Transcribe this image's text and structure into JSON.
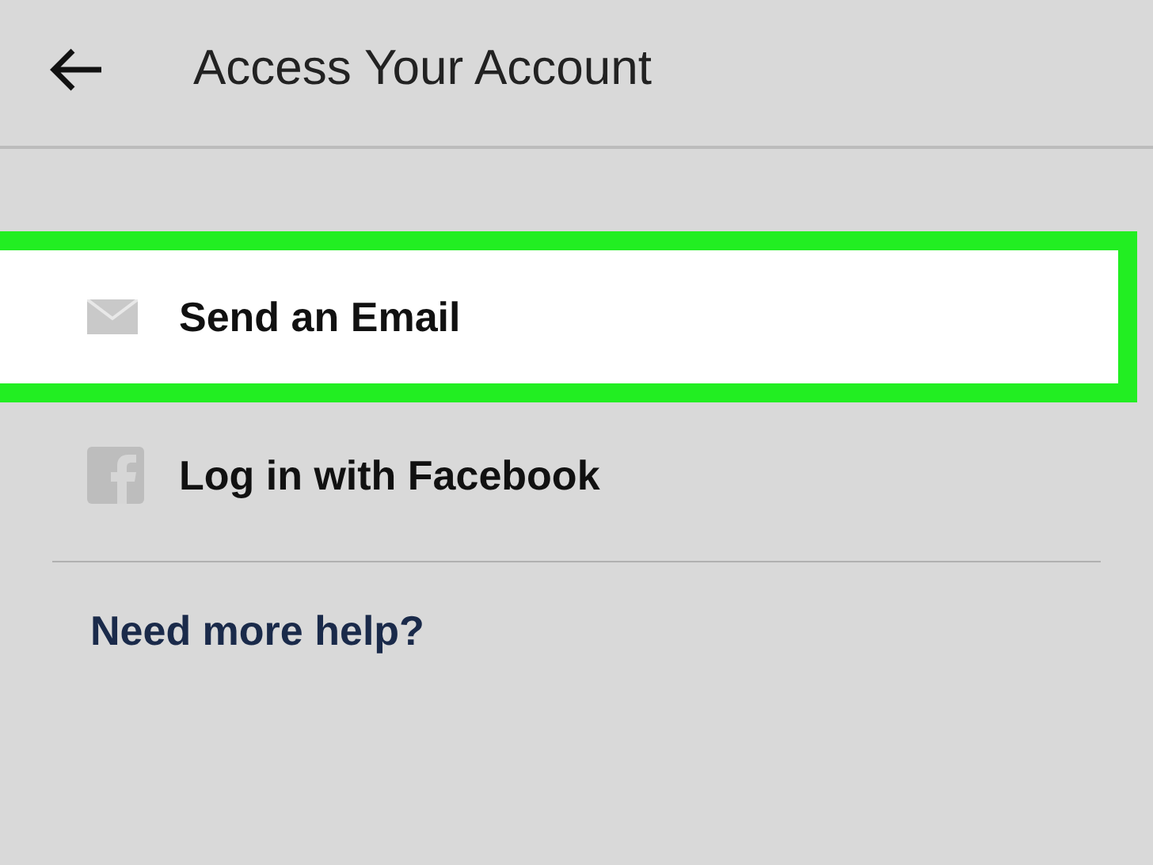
{
  "header": {
    "title": "Access Your Account"
  },
  "options": [
    {
      "kind": "email",
      "label": "Send an Email",
      "selected": true
    },
    {
      "kind": "facebook",
      "label": "Log in with Facebook",
      "selected": false
    }
  ],
  "help_link": "Need more help?"
}
